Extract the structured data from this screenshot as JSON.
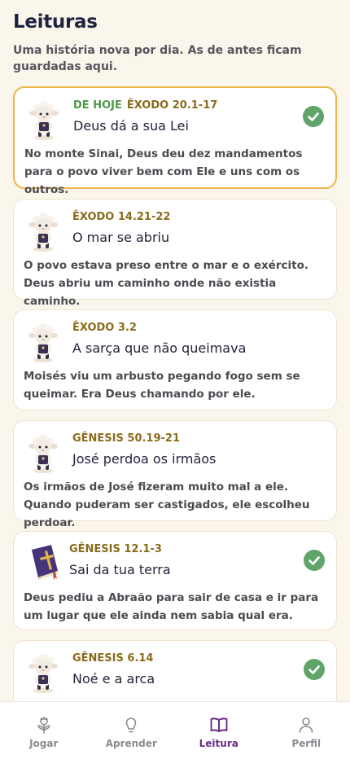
{
  "page": {
    "title": "Leituras",
    "subtitle": "Uma história nova por dia. As de antes ficam guardadas aqui."
  },
  "colors": {
    "accent_purple": "#6a2d86",
    "today_border": "#eab84a",
    "today_badge": "#4f9a48",
    "reference": "#8a6b1d",
    "check": "#5fa56a",
    "background": "#fbf6ec"
  },
  "readings": [
    {
      "badge": "DE HOJE",
      "reference": "ÊXODO 20.1-17",
      "title": "Deus dá a sua Lei",
      "description": "No monte Sinai, Deus deu dez mandamentos para o povo viver bem com Ele e uns com os outros.",
      "completed": true,
      "icon": "lamb-icon"
    },
    {
      "badge": "",
      "reference": "ÊXODO 14.21-22",
      "title": "O mar se abriu",
      "description": "O povo estava preso entre o mar e o exército. Deus abriu um caminho onde não existia caminho.",
      "completed": false,
      "icon": "lamb-icon"
    },
    {
      "badge": "",
      "reference": "ÊXODO 3.2",
      "title": "A sarça que não queimava",
      "description": "Moisés viu um arbusto pegando fogo sem se queimar. Era Deus chamando por ele.",
      "completed": false,
      "icon": "lamb-icon"
    },
    {
      "badge": "",
      "reference": "GÊNESIS 50.19-21",
      "title": "José perdoa os irmãos",
      "description": "Os irmãos de José fizeram muito mal a ele. Quando puderam ser castigados, ele escolheu perdoar.",
      "completed": false,
      "icon": "lamb-icon"
    },
    {
      "badge": "",
      "reference": "GÊNESIS 12.1-3",
      "title": "Sai da tua terra",
      "description": "Deus pediu a Abraão para sair de casa e ir para um lugar que ele ainda nem sabia qual era.",
      "completed": true,
      "icon": "bible-icon"
    },
    {
      "badge": "",
      "reference": "GÊNESIS 6.14",
      "title": "Noé e a arca",
      "description": "",
      "completed": true,
      "icon": "lamb-icon"
    }
  ],
  "nav": [
    {
      "label": "Jogar",
      "icon": "flower-icon",
      "active": false
    },
    {
      "label": "Aprender",
      "icon": "lightbulb-icon",
      "active": false
    },
    {
      "label": "Leitura",
      "icon": "open-book-icon",
      "active": true
    },
    {
      "label": "Perfil",
      "icon": "person-icon",
      "active": false
    }
  ]
}
